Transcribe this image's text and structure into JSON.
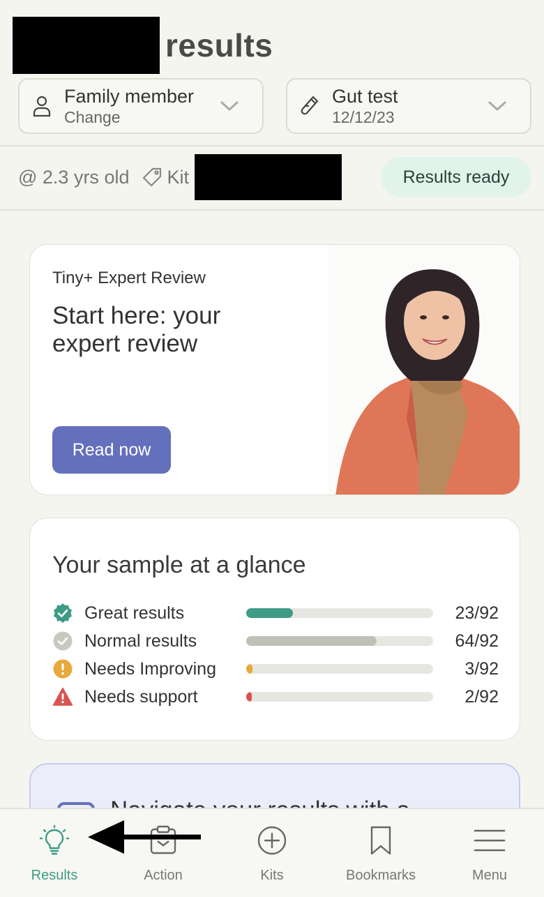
{
  "header": {
    "title": "results"
  },
  "selectors": {
    "member": {
      "main": "Family member",
      "sub": "Change"
    },
    "test": {
      "main": "Gut test",
      "sub": "12/12/23"
    }
  },
  "meta": {
    "age": "@ 2.3 yrs old",
    "kit_label": "Kit",
    "status": "Results ready"
  },
  "expert_card": {
    "eyebrow": "Tiny+ Expert Review",
    "heading": "Start here: your expert review",
    "button": "Read now"
  },
  "glance": {
    "title": "Your sample at a glance",
    "rows": [
      {
        "label": "Great results",
        "count": "23/92",
        "icon": "check-badge-icon",
        "color": "#3e9b86",
        "fraction": 0.25
      },
      {
        "label": "Normal results",
        "count": "64/92",
        "icon": "check-circle-icon",
        "color": "#c0c0b6",
        "fraction": 0.696
      },
      {
        "label": "Needs Improving",
        "count": "3/92",
        "icon": "exclamation-circle-icon",
        "color": "#e8a93c",
        "fraction": 0.033
      },
      {
        "label": "Needs support",
        "count": "2/92",
        "icon": "warning-triangle-icon",
        "color": "#d9534f",
        "fraction": 0.022
      }
    ]
  },
  "navigate_card": {
    "text": "Navigate your results with a"
  },
  "bottom_nav": {
    "items": [
      {
        "label": "Results",
        "icon": "lightbulb-icon",
        "active": true
      },
      {
        "label": "Action",
        "icon": "clipboard-icon",
        "active": false
      },
      {
        "label": "Kits",
        "icon": "plus-circle-icon",
        "active": false
      },
      {
        "label": "Bookmarks",
        "icon": "bookmark-icon",
        "active": false
      },
      {
        "label": "Menu",
        "icon": "hamburger-icon",
        "active": false
      }
    ]
  },
  "colors": {
    "accent": "#3e9b86",
    "button": "#6470bb",
    "badge_bg": "#e2f3ec"
  }
}
